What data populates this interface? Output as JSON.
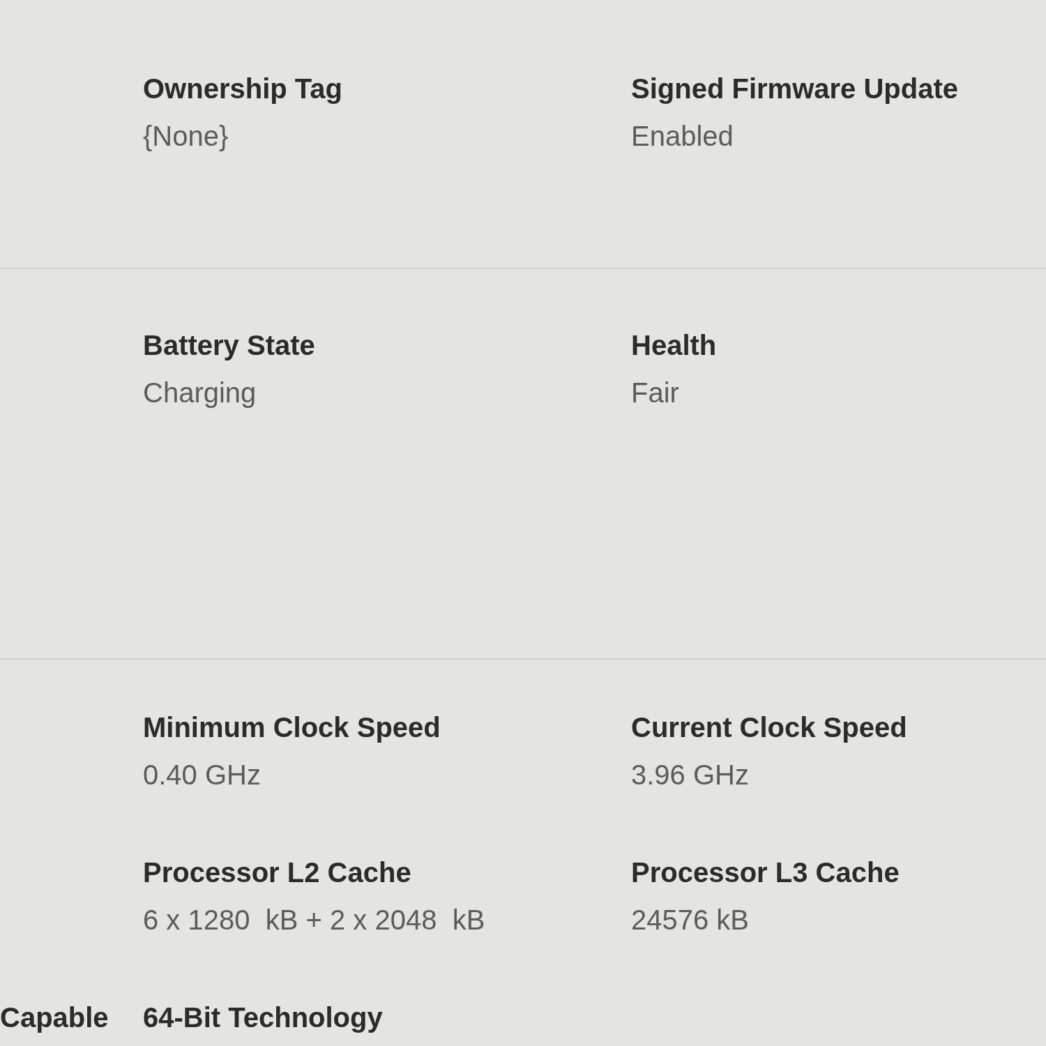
{
  "sections": [
    {
      "rows": [
        {
          "fields": [
            {
              "label": "Ownership Tag",
              "value": "{None}"
            },
            {
              "label": "Signed Firmware Update",
              "value": "Enabled"
            }
          ]
        }
      ]
    },
    {
      "rows": [
        {
          "fields": [
            {
              "label": "Battery State",
              "value": "Charging"
            },
            {
              "label": "Health",
              "value": "Fair"
            }
          ]
        }
      ]
    },
    {
      "rows": [
        {
          "fields": [
            {
              "label": "Minimum Clock Speed",
              "value": "0.40 GHz"
            },
            {
              "label": "Current Clock Speed",
              "value": "3.96 GHz"
            }
          ]
        },
        {
          "fields": [
            {
              "label": "Processor L2 Cache",
              "value": "6 x 1280  kB + 2 x 2048  kB"
            },
            {
              "label": "Processor L3 Cache",
              "value": "24576 kB"
            }
          ]
        },
        {
          "side_label": "Capable",
          "fields": [
            {
              "label": "64-Bit Technology"
            }
          ]
        }
      ]
    }
  ]
}
